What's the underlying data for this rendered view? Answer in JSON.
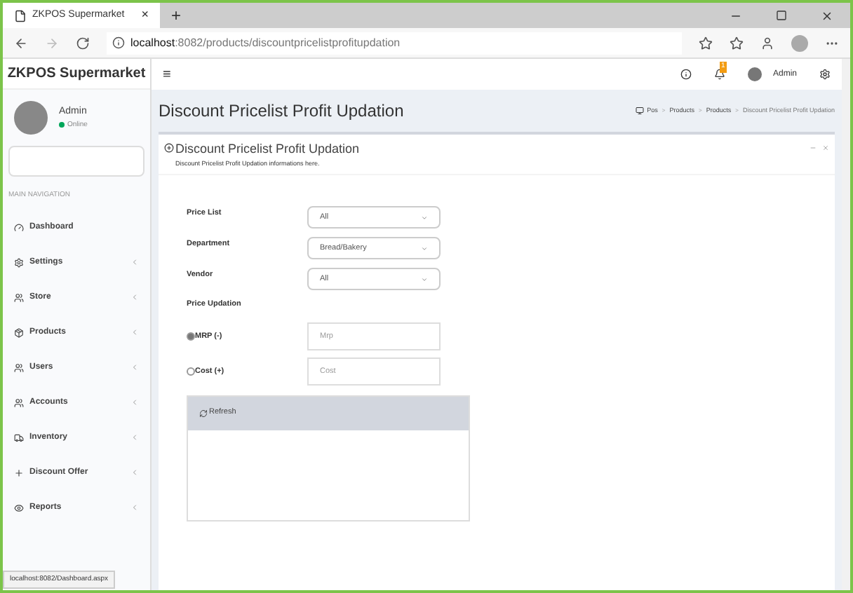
{
  "browser": {
    "tab_title": "ZKPOS Supermarket",
    "tab_close": "×",
    "new_tab": "+",
    "url_host": "localhost",
    "url_path": ":8082/products/discountpricelistprofitupdation",
    "status_url": "localhost:8082/Dashboard.aspx"
  },
  "header": {
    "brand": "ZKPOS Supermarket",
    "menu_glyph": "≡",
    "notification_count": "1",
    "user": "Admin"
  },
  "sidebar": {
    "user": {
      "name": "Admin",
      "status": "Online"
    },
    "section": "MAIN NAVIGATION",
    "items": [
      {
        "label": "Dashboard",
        "kind": "link"
      },
      {
        "label": "Settings",
        "kind": "menu"
      },
      {
        "label": "Store",
        "kind": "menu"
      },
      {
        "label": "Products",
        "kind": "menu"
      },
      {
        "label": "Users",
        "kind": "menu"
      },
      {
        "label": "Accounts",
        "kind": "menu"
      },
      {
        "label": "Inventory",
        "kind": "menu"
      },
      {
        "label": "Discount Offer",
        "kind": "menu"
      },
      {
        "label": "Reports",
        "kind": "menu"
      }
    ]
  },
  "page": {
    "title": "Discount Pricelist Profit Updation",
    "breadcrumb_separator": ">",
    "breadcrumb": [
      "Pos",
      "Products",
      "Products",
      "Discount Pricelist Profit Updation"
    ]
  },
  "panel": {
    "title": "Discount Pricelist Profit Updation",
    "subtitle": "Discount Pricelist Profit Updation informations here.",
    "selects": [
      {
        "label": "Price List",
        "value": "All"
      },
      {
        "label": "Department",
        "value": "Bread/Bakery"
      },
      {
        "label": "Vendor",
        "value": "All"
      }
    ],
    "section_label": "Price Updation",
    "options": [
      {
        "label": "MRP (-)",
        "placeholder": "Mrp",
        "selected": true
      },
      {
        "label": "Cost (+)",
        "placeholder": "Cost",
        "selected": false
      }
    ],
    "refresh": "Refresh"
  }
}
